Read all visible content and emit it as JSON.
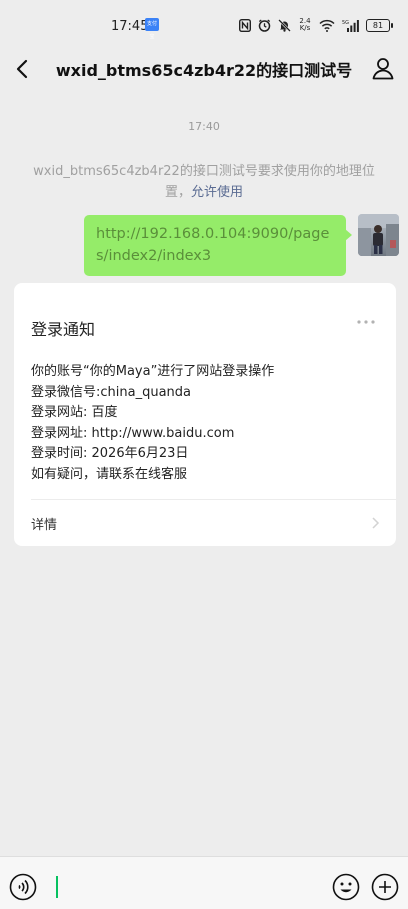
{
  "status_bar": {
    "time": "17:45",
    "app_badge": "支付宝",
    "network_speed_value": "2.4",
    "network_speed_unit": "K/s",
    "signal_label": "5G",
    "battery": "81",
    "icons": [
      "nfc-icon",
      "alarm-icon",
      "mute-icon",
      "wifi-icon",
      "signal-icon",
      "battery-icon"
    ]
  },
  "header": {
    "title": "wxid_btms65c4zb4r22的接口测试号",
    "back_icon": "chevron-left-icon",
    "profile_icon": "person-icon"
  },
  "chat": {
    "timestamp": "17:40",
    "system_note": "wxid_btms65c4zb4r22的接口测试号要求使用你的地理位置，",
    "system_link": "允许使用",
    "sent_message": "http://192.168.0.104:9090/pages/index2/index3"
  },
  "notice_card": {
    "title": "登录通知",
    "lines": [
      "你的账号“你的Maya”进行了网站登录操作",
      "登录微信号:china_quanda",
      "登录网站: 百度",
      "登录网址: http://www.baidu.com",
      "登录时间: 2026年6月23日",
      "如有疑问，请联系在线客服"
    ],
    "details_label": "详情"
  },
  "input_bar": {
    "placeholder": "",
    "voice_icon": "voice-icon",
    "emoji_icon": "emoji-icon",
    "plus_icon": "plus-icon"
  },
  "colors": {
    "background": "#ededed",
    "bubble": "#95ec69",
    "link": "#5a6b92",
    "caret": "#07c160"
  }
}
